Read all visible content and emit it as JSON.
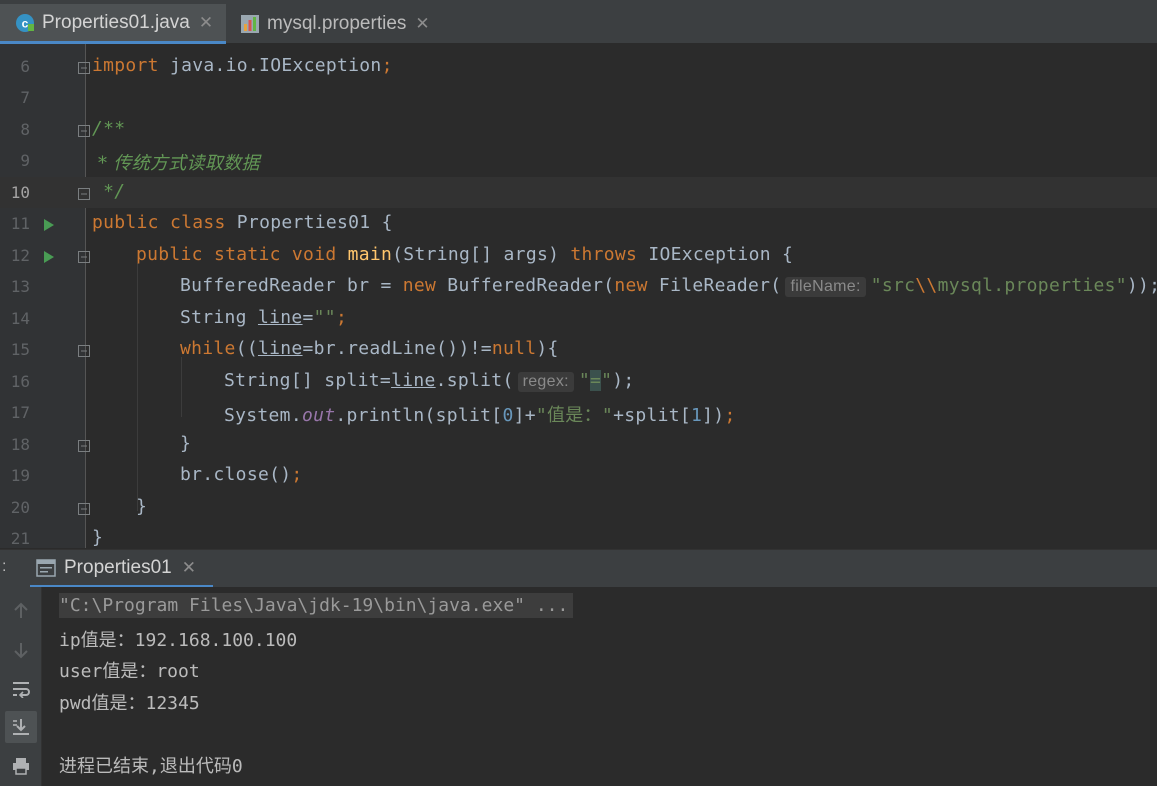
{
  "tabs": [
    {
      "label": "Properties01.java",
      "icon": "java-class-icon",
      "active": true
    },
    {
      "label": "mysql.properties",
      "icon": "properties-file-icon",
      "active": false
    }
  ],
  "editor": {
    "lines": [
      "6",
      "7",
      "8",
      "9",
      "10",
      "11",
      "12",
      "13",
      "14",
      "15",
      "16",
      "17",
      "18",
      "19",
      "20",
      "21"
    ],
    "code": {
      "l6_import": "import",
      "l6_rest": " java.io.IOException",
      "l6_semi": ";",
      "l8": "/**",
      "l9": " * 传统方式读取数据",
      "l10": " */",
      "l11_kw": "public class",
      "l11_rest": " Properties01 {",
      "l12_kw1": "public static void",
      "l12_fn": "main",
      "l12_mid": "(String[] args) ",
      "l12_kw2": "throws",
      "l12_end": " IOException {",
      "l13_a": "BufferedReader br = ",
      "l13_new1": "new",
      "l13_b": " BufferedReader(",
      "l13_new2": "new",
      "l13_c": " FileReader(",
      "l13_hint": "fileName:",
      "l13_str1": "\"src",
      "l13_esc": "\\\\",
      "l13_str2": "mysql.properties\"",
      "l13_end": "));",
      "l14_a": "String ",
      "l14_var": "line",
      "l14_eq": "=",
      "l14_str": "\"\"",
      "l14_semi": ";",
      "l15_kw": "while",
      "l15_a": "((",
      "l15_var": "line",
      "l15_b": "=br.readLine())!=",
      "l15_null": "null",
      "l15_c": "){",
      "l16_a": "String[] split=",
      "l16_var": "line",
      "l16_b": ".split(",
      "l16_hint": "regex:",
      "l16_q1": "\"",
      "l16_eq": "=",
      "l16_q2": "\"",
      "l16_end": ");",
      "l17_a": "System.",
      "l17_out": "out",
      "l17_b": ".println(split[",
      "l17_n0": "0",
      "l17_c": "]+",
      "l17_str": "\"值是：\"",
      "l17_d": "+split[",
      "l17_n1": "1",
      "l17_e": "])",
      "l17_semi": ";",
      "l18": "}",
      "l19_a": "br.close()",
      "l19_semi": ";",
      "l20": "}",
      "l21": "}"
    }
  },
  "run_panel": {
    "colon": ":",
    "tab_label": "Properties01",
    "output": [
      "\"C:\\Program Files\\Java\\jdk-19\\bin\\java.exe\" ...",
      "ip值是：192.168.100.100",
      "user值是：root",
      "pwd值是：12345",
      "",
      "进程已结束,退出代码0"
    ],
    "tools": [
      "up-arrow-icon",
      "down-arrow-icon",
      "soft-wrap-icon",
      "scroll-to-end-icon",
      "print-icon"
    ]
  },
  "colors": {
    "accent": "#4a88c7",
    "keyword": "#cc7832",
    "string": "#6a8759",
    "comment": "#629755",
    "number": "#6897bb",
    "method": "#ffc66d"
  }
}
